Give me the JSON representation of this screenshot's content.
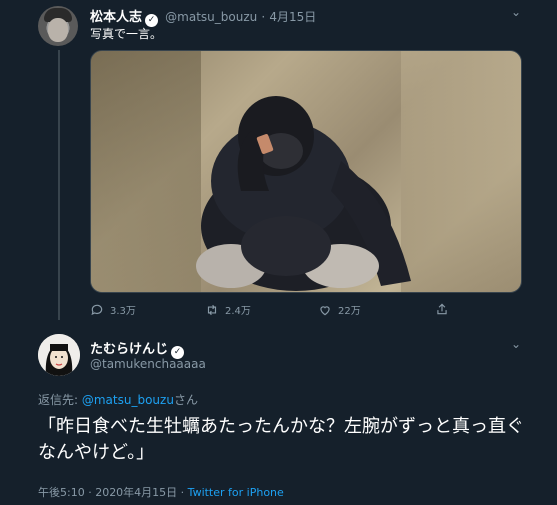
{
  "tweet1": {
    "name": "松本人志",
    "handle": "@matsu_bouzu",
    "dot": "·",
    "date": "4月15日",
    "text": "写真で一言。",
    "reply_count": "3.3万",
    "retweet_count": "2.4万",
    "like_count": "22万"
  },
  "tweet2": {
    "name": "たむらけんじ",
    "handle": "@tamukenchaaaaa",
    "reply_prefix": "返信先: ",
    "reply_target": "@matsu_bouzu",
    "reply_suffix": "さん",
    "text": "「昨日食べた生牡蠣あたったんかな？左腕がずっと真っ直ぐなんやけど。」",
    "time": "午後5:10 · 2020年4月15日 · ",
    "client": "Twitter for iPhone"
  },
  "icons": {
    "verified": "✓",
    "caret": "⌄"
  },
  "colors": {
    "background": "#15202b",
    "accent": "#1da1f2",
    "muted": "#8899a6"
  }
}
